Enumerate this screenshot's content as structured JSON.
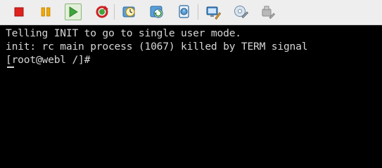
{
  "toolbar": {
    "buttons": [
      {
        "name": "stop-button",
        "icon": "stop-square-icon",
        "color": "#e0211d"
      },
      {
        "name": "pause-button",
        "icon": "pause-icon",
        "color": "#f0a800"
      },
      {
        "name": "play-button",
        "icon": "play-triangle-icon",
        "color": "#3fa43a",
        "pressed": true
      },
      {
        "name": "reset-button",
        "icon": "refresh-icon",
        "color": "#cc2222"
      },
      {
        "name": "snapshot-button",
        "icon": "clock-snapshot-icon"
      },
      {
        "name": "revert-snapshot-button",
        "icon": "revert-snapshot-icon"
      },
      {
        "name": "snapshot-manager-button",
        "icon": "snapshot-manager-icon"
      },
      {
        "name": "edit-settings-button",
        "icon": "monitor-settings-icon"
      },
      {
        "name": "network-button",
        "icon": "network-disk-icon"
      },
      {
        "name": "disabled-settings-button",
        "icon": "disabled-settings-icon",
        "disabled": true
      }
    ]
  },
  "terminal": {
    "lines": [
      "Telling INIT to go to single user mode.",
      "init: rc main process (1067) killed by TERM signal"
    ],
    "prompt": "[root@webl /]# "
  },
  "colors": {
    "terminal_background": "#000000",
    "terminal_text": "#d6d6d6",
    "toolbar_background": "#eeeeee"
  }
}
